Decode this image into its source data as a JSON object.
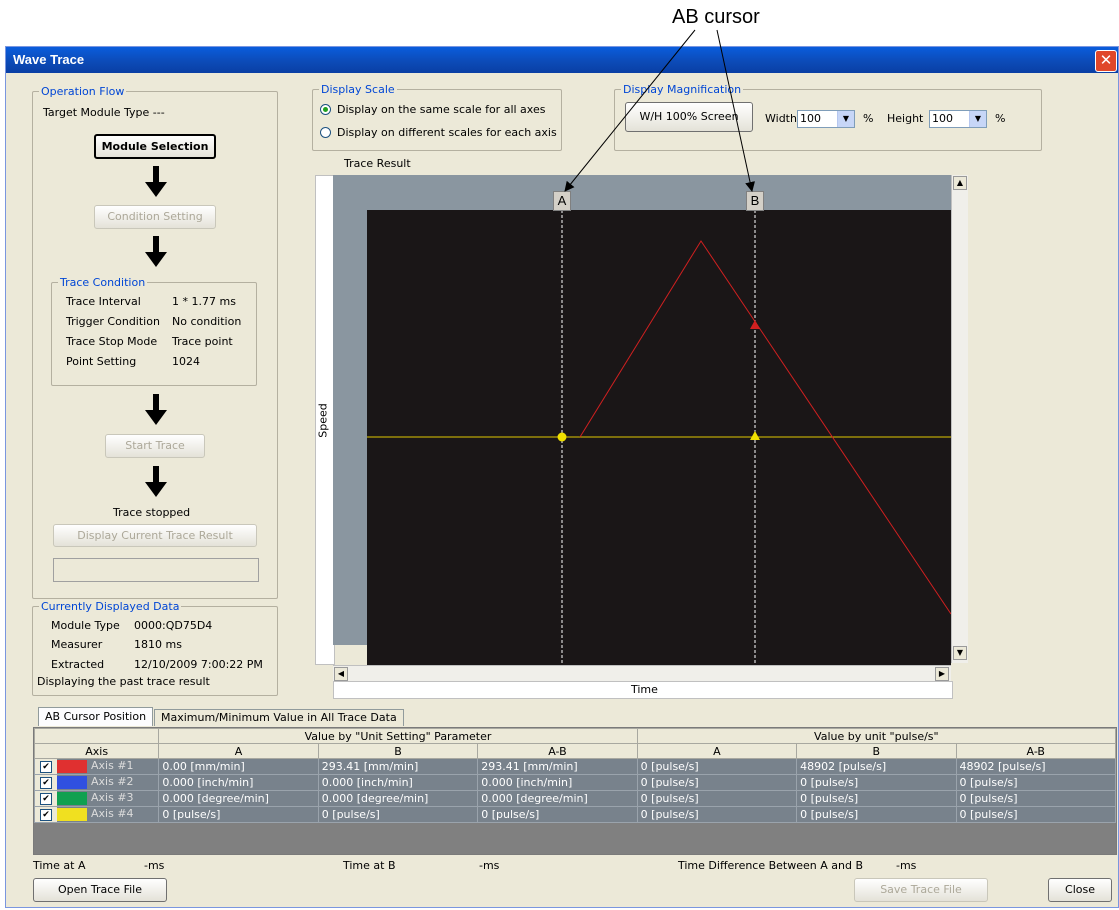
{
  "annotation": {
    "label": "AB cursor"
  },
  "window": {
    "title": "Wave Trace",
    "close_glyph": "✕"
  },
  "operation_flow": {
    "group_title": "Operation Flow",
    "target_module_type": "Target Module Type ---",
    "module_selection": "Module Selection",
    "condition_setting": "Condition Setting",
    "trace_condition": {
      "group_title": "Trace Condition",
      "rows": [
        {
          "label": "Trace Interval",
          "value": "1 * 1.77 ms"
        },
        {
          "label": "Trigger Condition",
          "value": "No condition"
        },
        {
          "label": "Trace Stop Mode",
          "value": "Trace point"
        },
        {
          "label": "Point Setting",
          "value": "1024"
        }
      ]
    },
    "start_trace": "Start Trace",
    "status": "Trace stopped",
    "display_current": "Display Current Trace Result"
  },
  "current_data": {
    "group_title": "Currently Displayed Data",
    "rows": [
      {
        "label": "Module Type",
        "value": "0000:QD75D4"
      },
      {
        "label": "Measurer",
        "value": "1810 ms"
      },
      {
        "label": "Extracted",
        "value": "12/10/2009 7:00:22 PM"
      }
    ],
    "note": "Displaying the past trace result"
  },
  "display_scale": {
    "group_title": "Display Scale",
    "options": [
      "Display on the same scale for all axes",
      "Display on different scales for each axis"
    ],
    "selected_index": 0
  },
  "magnification": {
    "group_title": "Display Magnification",
    "button": "W/H 100% Screen",
    "width_label": "Width",
    "width_value": "100",
    "width_unit": "%",
    "height_label": "Height",
    "height_value": "100",
    "height_unit": "%"
  },
  "trace_result": {
    "title": "Trace Result",
    "y_label": "Speed",
    "x_label": "Time",
    "cursor_a": "A",
    "cursor_b": "B",
    "colors": {
      "background": "#1a1617",
      "red_series": "#d02020",
      "yellow_series": "#e0c800"
    }
  },
  "tabs": [
    "AB Cursor Position",
    "Maximum/Minimum Value in All Trace Data"
  ],
  "table": {
    "group_unit_setting": "Value by \"Unit Setting\" Parameter",
    "group_unit": "Value by unit  \"pulse/s\"",
    "axis_header": "Axis",
    "col_a": "A",
    "col_b": "B",
    "col_ab": "A-B",
    "rows": [
      {
        "color": "#e03030",
        "axis": "Axis #1",
        "ua": "0.00 [mm/min]",
        "ub": "293.41 [mm/min]",
        "uab": "293.41 [mm/min]",
        "pa": "0 [pulse/s]",
        "pb": "48902 [pulse/s]",
        "pab": "48902 [pulse/s]"
      },
      {
        "color": "#3050e0",
        "axis": "Axis #2",
        "ua": "0.000 [inch/min]",
        "ub": "0.000 [inch/min]",
        "uab": "0.000 [inch/min]",
        "pa": "0 [pulse/s]",
        "pb": "0 [pulse/s]",
        "pab": "0 [pulse/s]"
      },
      {
        "color": "#10a050",
        "axis": "Axis #3",
        "ua": "0.000 [degree/min]",
        "ub": "0.000 [degree/min]",
        "uab": "0.000 [degree/min]",
        "pa": "0 [pulse/s]",
        "pb": "0 [pulse/s]",
        "pab": "0 [pulse/s]"
      },
      {
        "color": "#f0e020",
        "axis": "Axis #4",
        "ua": "0 [pulse/s]",
        "ub": "0 [pulse/s]",
        "uab": "0 [pulse/s]",
        "pa": "0 [pulse/s]",
        "pb": "0 [pulse/s]",
        "pab": "0 [pulse/s]"
      }
    ]
  },
  "footer": {
    "time_a_label": "Time at A",
    "time_a_value": "-ms",
    "time_b_label": "Time at B",
    "time_b_value": "-ms",
    "diff_label": "Time Difference Between A and B",
    "diff_value": "-ms",
    "open_button": "Open Trace File",
    "save_button": "Save Trace File",
    "close_button": "Close"
  }
}
